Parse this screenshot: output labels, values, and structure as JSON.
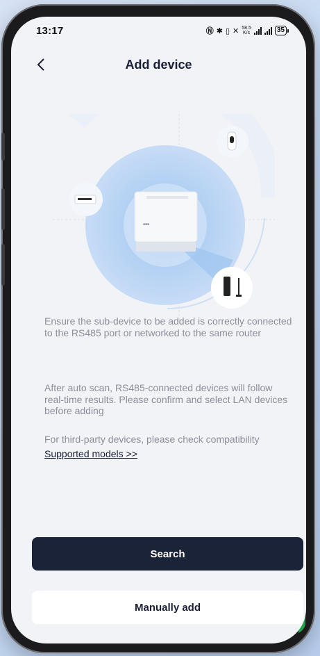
{
  "status_bar": {
    "time": "13:17",
    "net_speed_value": "58.5",
    "net_speed_unit": "K/s",
    "battery": "35"
  },
  "header": {
    "title": "Add device",
    "back_icon": "chevron-left-icon"
  },
  "instructions": [
    "Ensure the sub-device to be added is correctly connected to the RS485 port or networked to the same router",
    "After auto scan, RS485-connected devices will follow real-time results. Please confirm and select LAN devices before adding",
    "For third-party devices, please check compatibility"
  ],
  "supported_models_link": "Supported models >>",
  "buttons": {
    "search": "Search",
    "manual": "Manually add"
  },
  "colors": {
    "primary_button": "#1b2338",
    "text_muted": "#8a8f99",
    "title": "#1a1f36",
    "accent_blue": "#a9cdf3"
  }
}
